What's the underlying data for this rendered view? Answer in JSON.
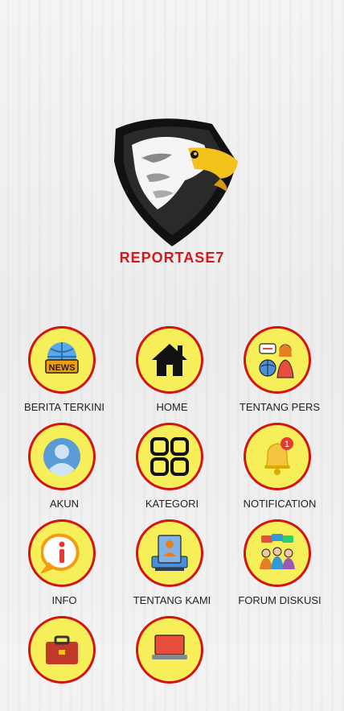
{
  "brand": {
    "name": "REPORTASE7"
  },
  "menu": [
    {
      "label": "BERITA TERKINI",
      "icon": "news-globe-icon"
    },
    {
      "label": "HOME",
      "icon": "home-icon"
    },
    {
      "label": "TENTANG PERS",
      "icon": "press-reporter-icon"
    },
    {
      "label": "AKUN",
      "icon": "user-account-icon"
    },
    {
      "label": "KATEGORI",
      "icon": "grid-categories-icon"
    },
    {
      "label": "NOTIFICATION",
      "icon": "bell-icon",
      "badge": "1"
    },
    {
      "label": "INFO",
      "icon": "info-icon"
    },
    {
      "label": "TENTANG KAMI",
      "icon": "about-us-icon"
    },
    {
      "label": "FORUM DISKUSI",
      "icon": "discussion-forum-icon"
    },
    {
      "label": "",
      "icon": "briefcase-icon"
    },
    {
      "label": "",
      "icon": "laptop-icon"
    }
  ],
  "colors": {
    "accent": "#d21414",
    "tile_fill": "#f7ef5a",
    "brand_text": "#d11b1b"
  }
}
